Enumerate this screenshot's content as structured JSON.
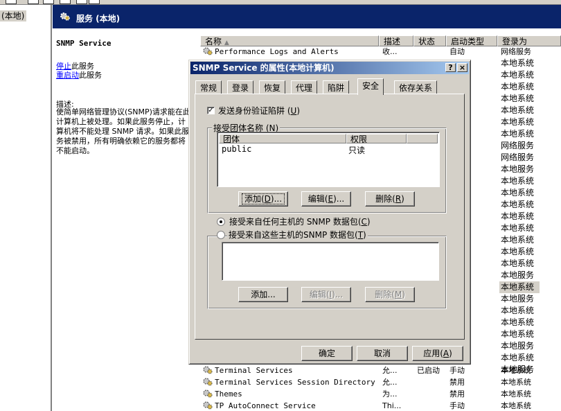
{
  "tree": {
    "root_label": "(本地)"
  },
  "services_pane": {
    "title": "服务 (本地)",
    "selected_name": "SNMP Service",
    "stop_link": "停止",
    "stop_suffix": "此服务",
    "restart_link": "重启动",
    "restart_suffix": "此服务",
    "desc_label": "描述:",
    "desc_text": "使简单网络管理协议(SNMP)请求能在此计算机上被处理。如果此服务停止，计算机将不能处理 SNMP 请求。如果此服务被禁用，所有明确依赖它的服务都将不能启动。"
  },
  "list": {
    "columns": [
      "名称",
      "描述",
      "状态",
      "启动类型",
      "登录为"
    ],
    "top_rows": [
      {
        "name": "Performance Logs and Alerts",
        "desc": "收...",
        "status": "",
        "startup": "自动",
        "logon": "网络服务"
      }
    ],
    "side_logons": [
      "本地系统",
      "本地系统",
      "本地系统",
      "本地系统",
      "本地系统",
      "本地系统",
      "本地系统",
      "网络服务",
      "网络服务",
      "本地服务",
      "本地系统",
      "本地系统",
      "本地系统",
      "本地系统",
      "本地系统",
      "本地系统",
      "本地系统",
      "本地系统",
      "本地服务",
      "本地系统",
      "本地服务",
      "本地系统",
      "本地系统",
      "本地系统",
      "本地服务",
      "本地系统",
      "本地服务"
    ],
    "selected_side_index": 19,
    "bottom_rows": [
      {
        "name": "Terminal Services",
        "desc": "允...",
        "status": "已启动",
        "startup": "手动",
        "logon": "本地系统"
      },
      {
        "name": "Terminal Services Session Directory",
        "desc": "允...",
        "status": "",
        "startup": "禁用",
        "logon": "本地系统"
      },
      {
        "name": "Themes",
        "desc": "为...",
        "status": "",
        "startup": "禁用",
        "logon": "本地系统"
      },
      {
        "name": "TP AutoConnect Service",
        "desc": "Thi...",
        "status": "",
        "startup": "手动",
        "logon": "本地系统"
      }
    ]
  },
  "dialog": {
    "title": "SNMP Service 的属性(本地计算机)",
    "help_btn": "?",
    "close_btn": "×",
    "tabs": [
      "常规",
      "登录",
      "恢复",
      "代理",
      "陷阱",
      "安全",
      "依存关系"
    ],
    "active_tab": "安全",
    "send_auth_trap": "发送身份验证陷阱",
    "send_auth_trap_key": "U",
    "send_auth_trap_checked": true,
    "accepted_communities_label": "接受团体名称",
    "accepted_communities_key": "N",
    "community_columns": [
      "团体",
      "权限"
    ],
    "communities": [
      {
        "name": "public",
        "rights": "只读"
      }
    ],
    "btn_add": "添加",
    "btn_add_key": "D",
    "btn_edit": "编辑",
    "btn_edit_key": "E",
    "btn_remove": "删除",
    "btn_remove_key": "R",
    "radio_any_host": "接受来自任何主机的 SNMP 数据包",
    "radio_any_host_key": "C",
    "radio_these_hosts": "接受来自这些主机的SNMP 数据包",
    "radio_these_hosts_key": "T",
    "selected_radio": "any",
    "hosts_btn_add": "添加...",
    "hosts_btn_edit": "编辑",
    "hosts_btn_edit_key": "I",
    "hosts_btn_remove": "删除",
    "hosts_btn_remove_key": "M",
    "ok": "确定",
    "cancel": "取消",
    "apply": "应用",
    "apply_key": "A"
  }
}
